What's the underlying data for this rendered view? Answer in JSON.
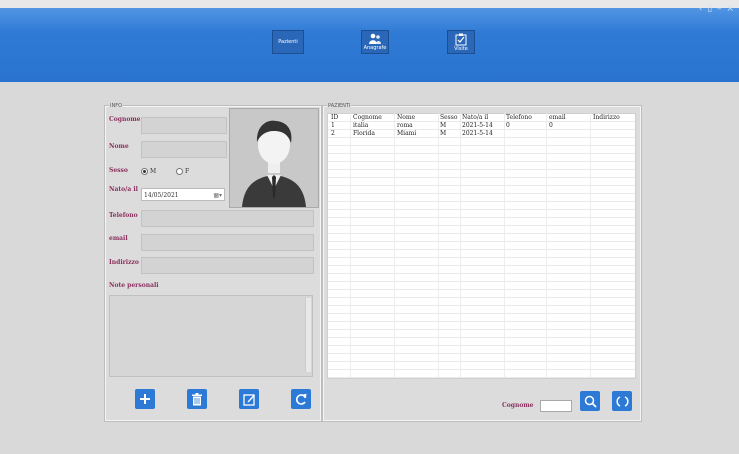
{
  "window": {
    "controls": "‹ ▯ –  ×"
  },
  "toolbar": {
    "btn1_label": "Pazienti",
    "btn2_label": "Anagrafe",
    "btn3_label": "Visite"
  },
  "info_group": "INFO",
  "form": {
    "cognome_label": "Cognome",
    "nome_label": "Nome",
    "sesso_label": "Sesso",
    "sesso_m": "M",
    "sesso_f": "F",
    "nato_label": "Nato/a il",
    "date_value": "14/05/2021",
    "telefono_label": "Telefono",
    "email_label": "email",
    "indirizzo_label": "Indirizzo",
    "note_label": "Note personali"
  },
  "patients_group": "PAZIENTI",
  "table": {
    "headers": [
      "ID",
      "Cognome",
      "Nome",
      "Sesso",
      "Nato/a il",
      "Telefono",
      "email",
      "Indirizzo"
    ],
    "rows": [
      [
        "1",
        "italia",
        "roma",
        "M",
        "2021-5-14",
        "0",
        "0",
        ""
      ],
      [
        "2",
        "Florida",
        "Miami",
        "M",
        "2021-5-14",
        "",
        "",
        ""
      ]
    ]
  },
  "search": {
    "label": "Cognome"
  },
  "colors": {
    "accent": "#2c7ad6",
    "topbar": "#2f7ad5",
    "label": "#8a2f5d"
  }
}
